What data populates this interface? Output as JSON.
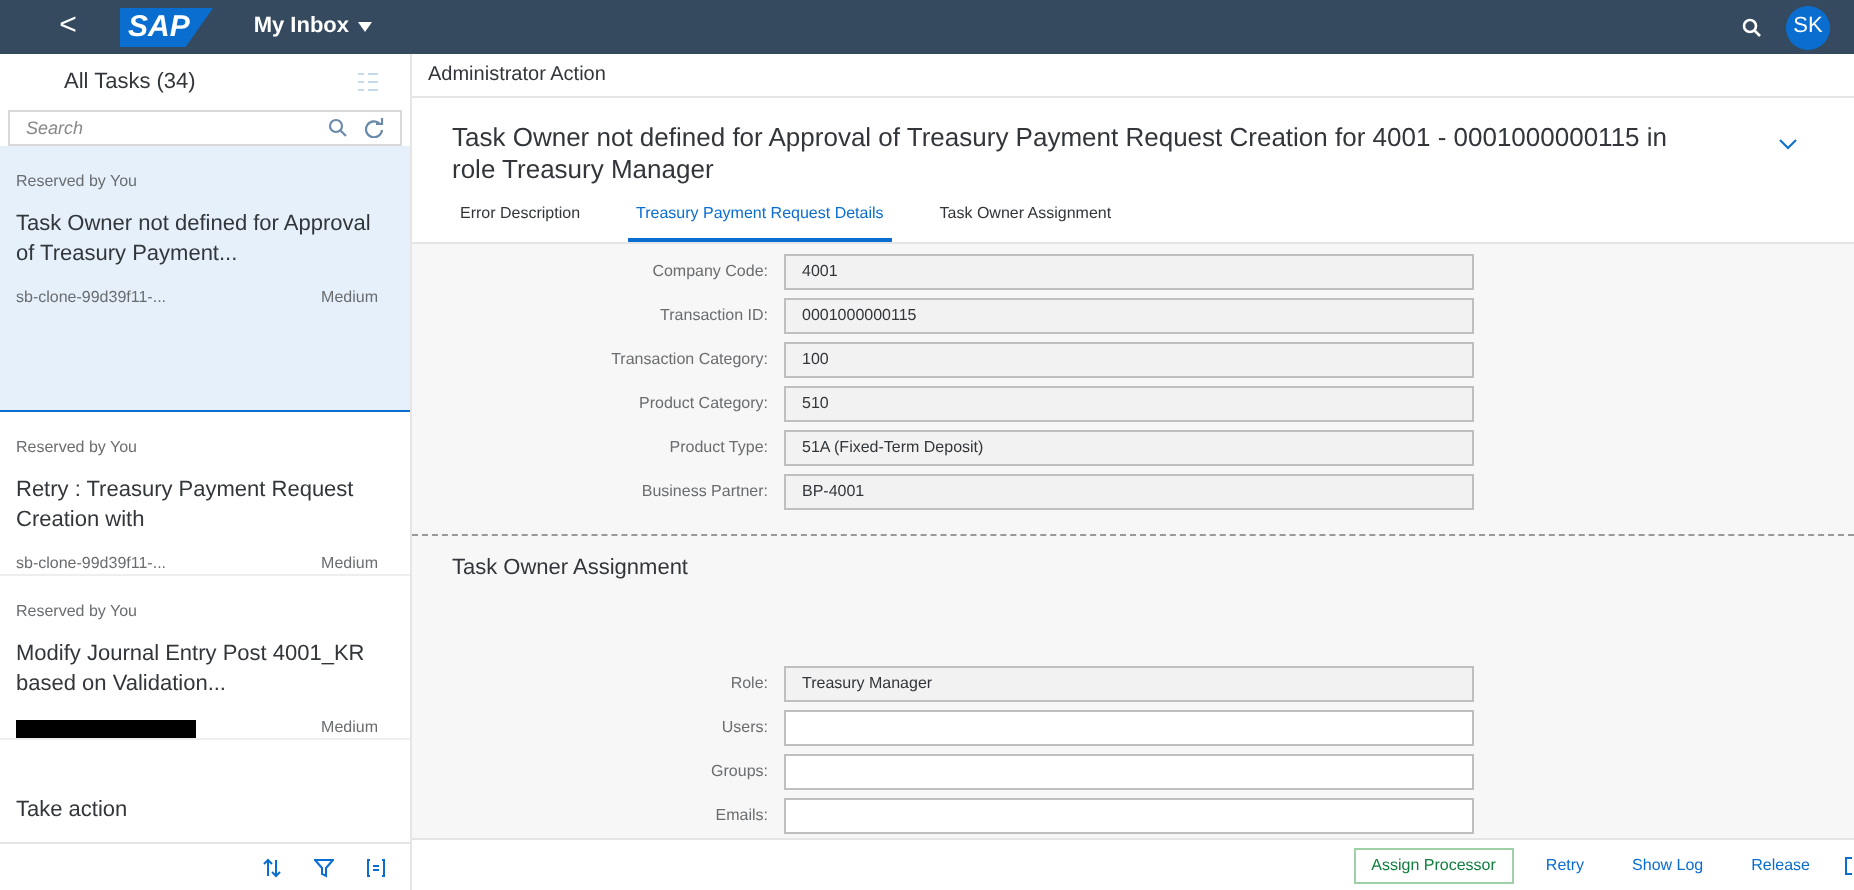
{
  "shell": {
    "back": "<",
    "logo": "SAP",
    "app_title": "My Inbox",
    "avatar": "SK"
  },
  "task_list": {
    "title": "All Tasks (34)",
    "search": {
      "placeholder": "Search"
    },
    "items": [
      {
        "kind": "task",
        "status": "Reserved by You",
        "title": "Task Owner not defined for Approval of Treasury Payment...",
        "origin": "sb-clone-99d39f11-...",
        "priority": "Medium",
        "selected": true
      },
      {
        "kind": "task",
        "status": "Reserved by You",
        "title": "Retry : Treasury Payment Request Creation with",
        "origin": "sb-clone-99d39f11-...",
        "priority": "Medium",
        "selected": false
      },
      {
        "kind": "task",
        "status": "Reserved by You",
        "title": "Modify Journal Entry Post 4001_KR based on Validation...",
        "origin_redacted": true,
        "priority": "Medium",
        "selected": false
      },
      {
        "kind": "action",
        "title": "Take action",
        "selected": false
      }
    ]
  },
  "detail": {
    "subheader": "Administrator Action",
    "title": "Task Owner not defined for Approval of Treasury Payment Request Creation for 4001 - 0001000000115 in role Treasury Manager",
    "tabs": [
      {
        "label": "Error Description",
        "selected": false
      },
      {
        "label": "Treasury Payment Request Details",
        "selected": true
      },
      {
        "label": "Task Owner Assignment",
        "selected": false
      }
    ],
    "details_fields": [
      {
        "label": "Company Code:",
        "value": "4001",
        "editable": false
      },
      {
        "label": "Transaction ID:",
        "value": "0001000000115",
        "editable": false
      },
      {
        "label": "Transaction Category:",
        "value": "100",
        "editable": false
      },
      {
        "label": "Product Category:",
        "value": "510",
        "editable": false
      },
      {
        "label": "Product Type:",
        "value": "51A (Fixed-Term Deposit)",
        "editable": false
      },
      {
        "label": "Business Partner:",
        "value": "BP-4001",
        "editable": false
      }
    ],
    "assignment": {
      "title": "Task Owner Assignment",
      "fields": [
        {
          "label": "Role:",
          "value": "Treasury Manager",
          "editable": false
        },
        {
          "label": "Users:",
          "editable": true
        },
        {
          "label": "Groups:",
          "editable": true
        },
        {
          "label": "Emails:",
          "editable": true
        }
      ]
    },
    "footer_buttons": [
      {
        "label": "Assign Processor",
        "emphasized": true
      },
      {
        "label": "Retry",
        "emphasized": false
      },
      {
        "label": "Show Log",
        "emphasized": false
      },
      {
        "label": "Release",
        "emphasized": false
      }
    ]
  }
}
